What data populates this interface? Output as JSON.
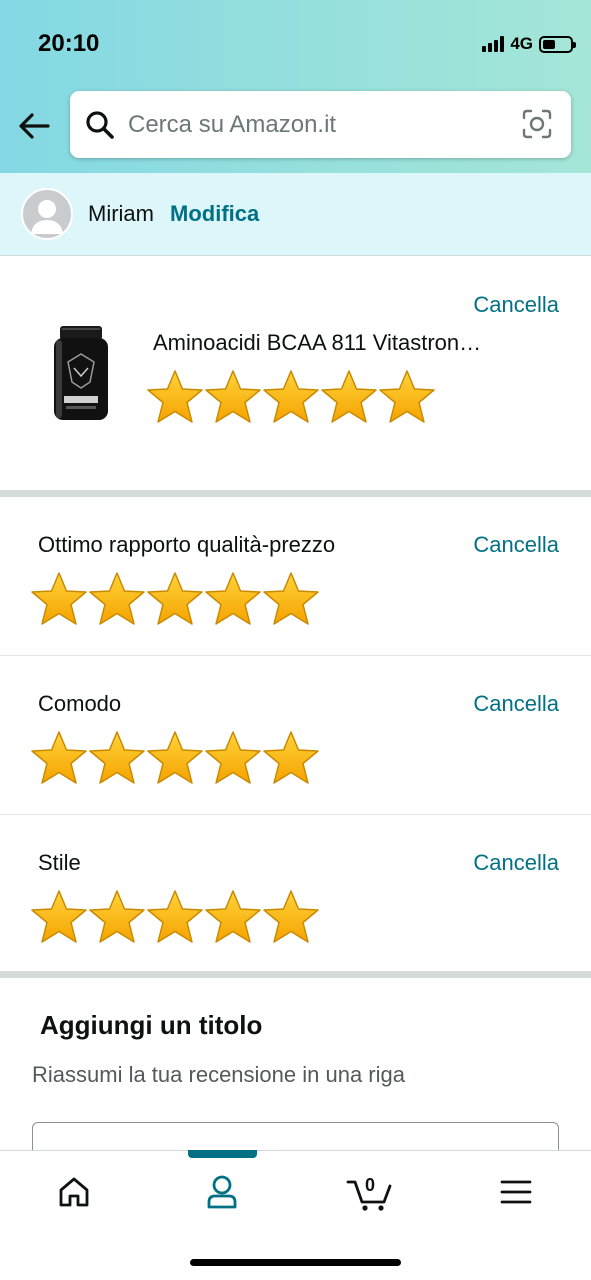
{
  "status_bar": {
    "time": "20:10",
    "network": "4G",
    "battery_level": 0.45
  },
  "header": {
    "back_icon": "arrow-left-icon",
    "search": {
      "placeholder": "Cerca su Amazon.it",
      "icon": "search-icon",
      "camera_icon": "camera-scan-icon"
    }
  },
  "profile": {
    "name": "Miriam",
    "edit_label": "Modifica"
  },
  "product": {
    "title": "Aminoacidi BCAA 811 Vitastron…",
    "cancel_label": "Cancella",
    "rating": 5,
    "max_rating": 5
  },
  "attributes": [
    {
      "label": "Ottimo rapporto qualità-prezzo",
      "cancel_label": "Cancella",
      "rating": 5
    },
    {
      "label": "Comodo",
      "cancel_label": "Cancella",
      "rating": 5
    },
    {
      "label": "Stile",
      "cancel_label": "Cancella",
      "rating": 5
    }
  ],
  "title_section": {
    "heading": "Aggiungi un titolo",
    "subtitle": "Riassumi la tua recensione in una riga",
    "value": ""
  },
  "tab_bar": {
    "tabs": [
      {
        "icon": "home-icon"
      },
      {
        "icon": "account-icon",
        "active": true
      },
      {
        "icon": "cart-icon",
        "count": "0"
      },
      {
        "icon": "menu-icon"
      }
    ]
  },
  "colors": {
    "accent": "#007185",
    "star": "#ffa41c",
    "header_start": "#84d8e3",
    "header_end": "#a5e6d7",
    "profile_bg": "#dcf6fa"
  }
}
